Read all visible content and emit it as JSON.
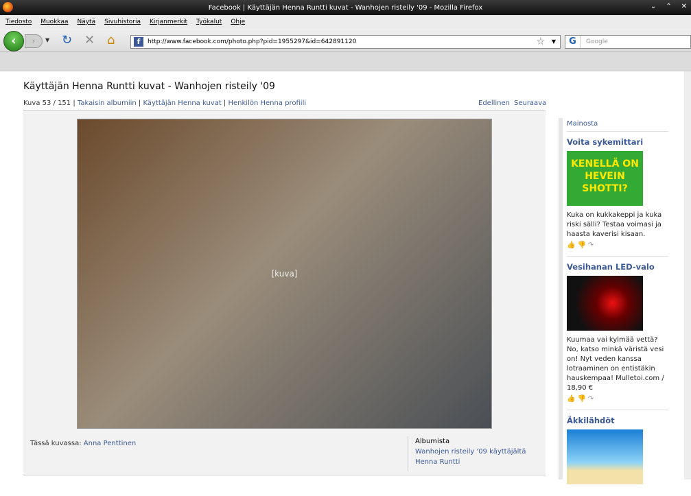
{
  "window": {
    "title": "Facebook | Käyttäjän Henna Runtti kuvat - Wanhojen risteily '09 - Mozilla Firefox"
  },
  "menu": [
    "Tiedosto",
    "Muokkaa",
    "Näytä",
    "Sivuhistoria",
    "Kirjanmerkit",
    "Työkalut",
    "Ohje"
  ],
  "nav": {
    "url": "http://www.facebook.com/photo.php?pid=1955297&id=642891120",
    "search_placeholder": "Google"
  },
  "page": {
    "title": "Käyttäjän Henna Runtti kuvat - Wanhojen risteily '09",
    "counter": "Kuva 53 / 151",
    "links": [
      "Takaisin albumiin",
      "Käyttäjän Henna kuvat",
      "Henkilön Henna profiili"
    ],
    "prev": "Edellinen",
    "next": "Seuraava",
    "photo_placeholder": "[kuva]",
    "tagged_label": "Tässä kuvassa:",
    "tagged_name": "Anna Penttinen",
    "album_label": "Albumista",
    "album_link": "Wanhojen risteily '09 käyttäjältä",
    "album_owner": "Henna Runtti"
  },
  "sidebar": {
    "header": "Mainosta",
    "ads": [
      {
        "title": "Voita sykemittari",
        "image_text": "KENELLÄ ON HEVEIN SHOTTI?",
        "desc": "Kuka on kukkakeppi ja kuka riski sälli? Testaa voimasi ja haasta kaverisi kisaan."
      },
      {
        "title": "Vesihanan LED-valo",
        "desc": "Kuumaa vai kylmää vettä? No, katso minkä väristä vesi on! Nyt veden kanssa lotraaminen on entistäkin hauskempaa! Mulletoi.com / 18,90 €"
      },
      {
        "title": "Äkkilähdöt"
      }
    ]
  }
}
